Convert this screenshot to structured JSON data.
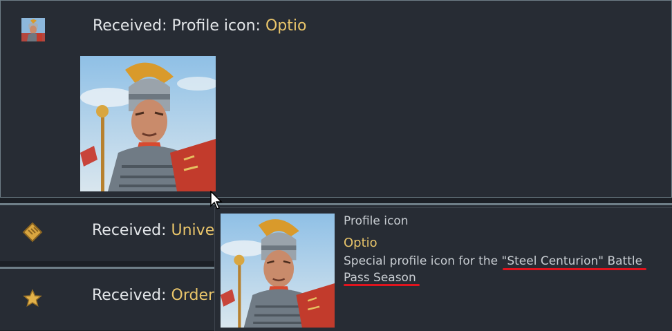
{
  "rows": [
    {
      "icon": "legionary-avatar-icon",
      "prefix": "Received: ",
      "category": "Profile icon: ",
      "name": "Optio"
    },
    {
      "icon": "universal-card-icon",
      "prefix": "Received: ",
      "name": "Univers"
    },
    {
      "icon": "star-icon",
      "prefix": "Received: ",
      "name": "Order \""
    }
  ],
  "tooltip": {
    "category": "Profile icon",
    "name": "Optio",
    "description_start": "Special profile icon for the ",
    "description_highlight": "\"Steel Centurion\" Battle Pass Season"
  },
  "colors": {
    "gold": "#e9c56a",
    "panel": "#272c34",
    "underline": "#e0141e"
  }
}
